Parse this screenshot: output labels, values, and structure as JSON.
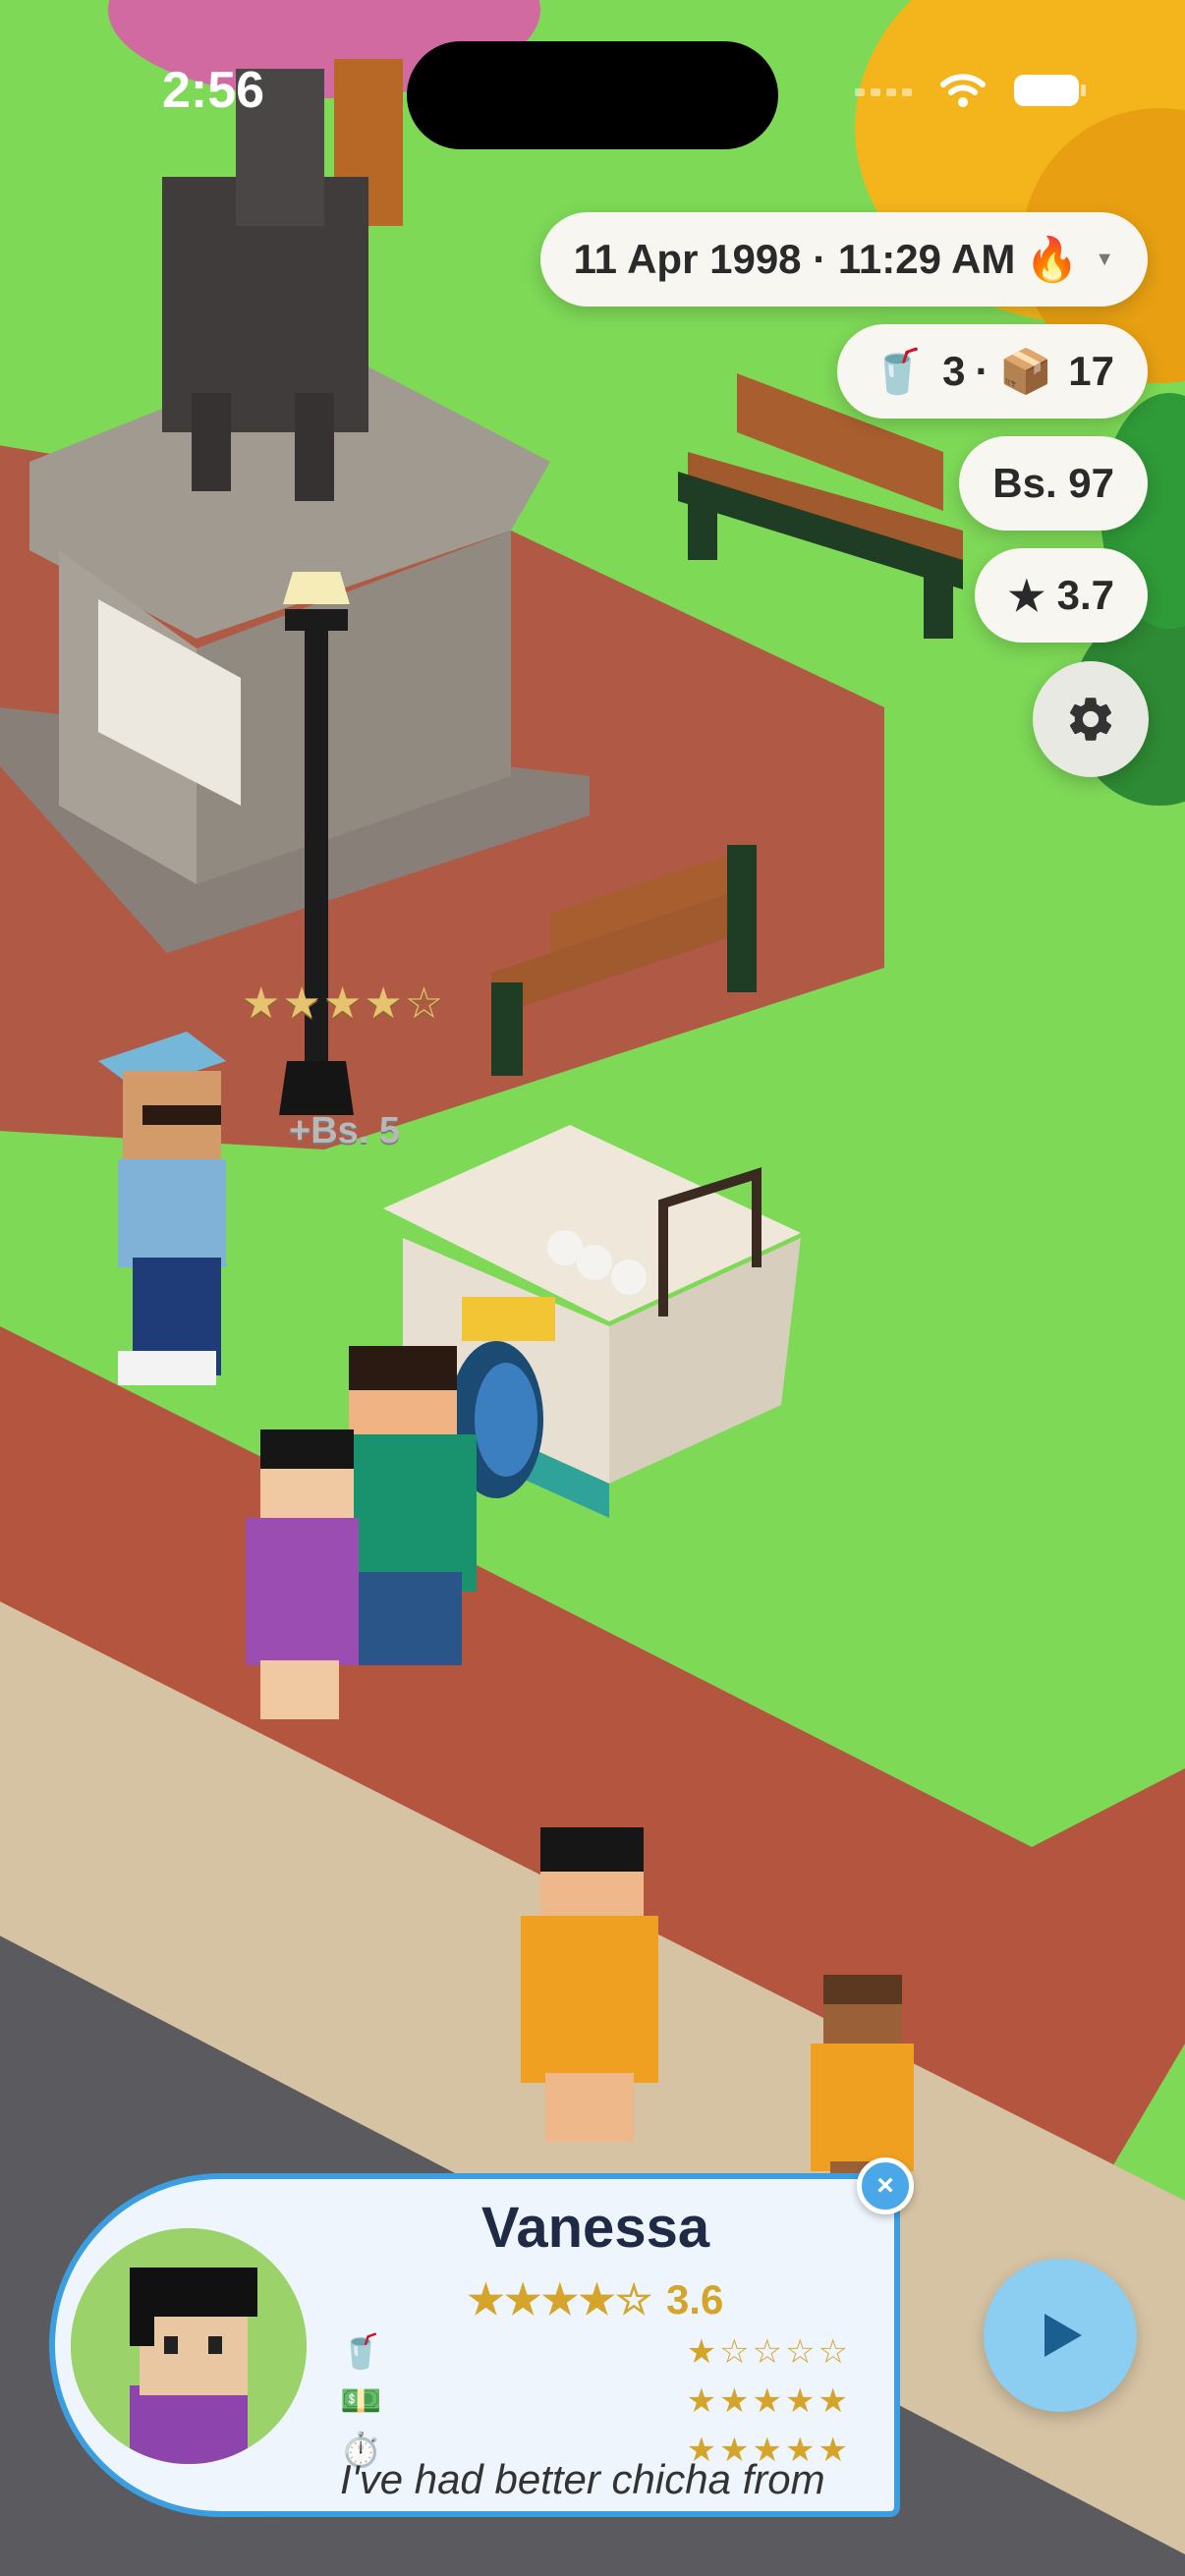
{
  "status_bar": {
    "time": "2:56"
  },
  "hud": {
    "datetime": "11 Apr 1998 · 11:29 AM",
    "datetime_icon": "🔥",
    "cups_icon": "🥤",
    "cups": "3",
    "separator": "·",
    "boxes_icon": "📦",
    "boxes": "17",
    "money": "Bs. 97",
    "rating_icon": "★",
    "rating": "3.7"
  },
  "floating": {
    "stars": "★★★★☆",
    "money": "+Bs. 5"
  },
  "customer": {
    "name": "Vanessa",
    "rating_stars": "★★★★☆",
    "rating": "3.6",
    "metrics": [
      {
        "icon": "🥤",
        "stars": "★☆☆☆☆",
        "score": 1
      },
      {
        "icon": "💵",
        "stars": "★★★★★",
        "score": 5
      },
      {
        "icon": "⏱️",
        "stars": "★★★★★",
        "score": 5
      }
    ],
    "quote": "I've had better chicha from"
  },
  "buttons": {
    "close": "×"
  },
  "colors": {
    "grass": "#7ed957",
    "plaza": "#b05a45",
    "sidewalk": "#d7c4a4",
    "road": "#5b5a5f",
    "accent_blue": "#3b9ee0",
    "star_gold": "#d4a52a"
  }
}
